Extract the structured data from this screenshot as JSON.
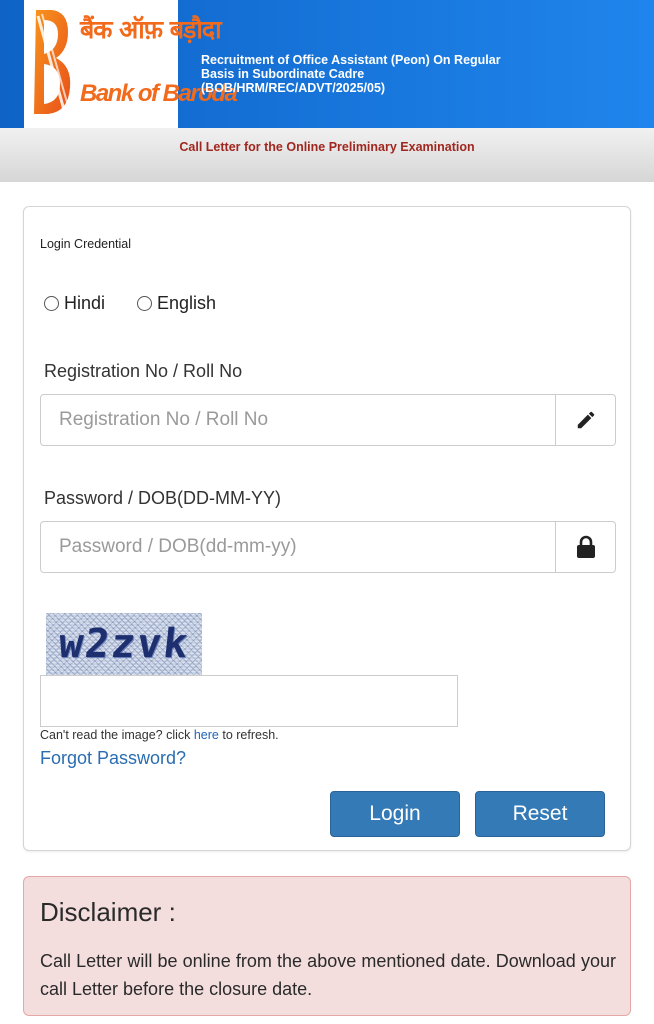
{
  "header": {
    "logo_hindi": "बैंक ऑफ़ बड़ौदा",
    "logo_english": "Bank of Baroda",
    "title_lines": [
      "Recruitment of Office Assistant (Peon) On Regular",
      "Basis in Subordinate Cadre",
      "(BOB/HRM/REC/ADVT/2025/05)"
    ],
    "bg_color": "#1a73d9",
    "logo_color": "#f26a1b"
  },
  "subheader": {
    "text": "Call Letter for the Online Preliminary Examination",
    "text_color": "#a0271f"
  },
  "login": {
    "card_title": "Login Credential",
    "language_options": [
      "Hindi",
      "English"
    ],
    "registration": {
      "label": "Registration No / Roll No",
      "placeholder": "Registration No / Roll No",
      "value": "",
      "icon": "pencil-icon"
    },
    "password": {
      "label": "Password / DOB(DD-MM-YY)",
      "placeholder": "Password / DOB(dd-mm-yy)",
      "value": "",
      "icon": "lock-icon"
    },
    "captcha": {
      "image_text": "w2zvk",
      "input_value": "",
      "help_prefix": "Can't read the image? click ",
      "help_link": "here",
      "help_suffix": " to refresh."
    },
    "forgot_password": "Forgot Password?",
    "login_button": "Login",
    "reset_button": "Reset",
    "button_color": "#337ab7"
  },
  "disclaimer": {
    "title": "Disclaimer :",
    "body": "Call Letter will be online from the above mentioned date. Download your call Letter before the closure date.",
    "bg_color": "#f3dedd"
  }
}
